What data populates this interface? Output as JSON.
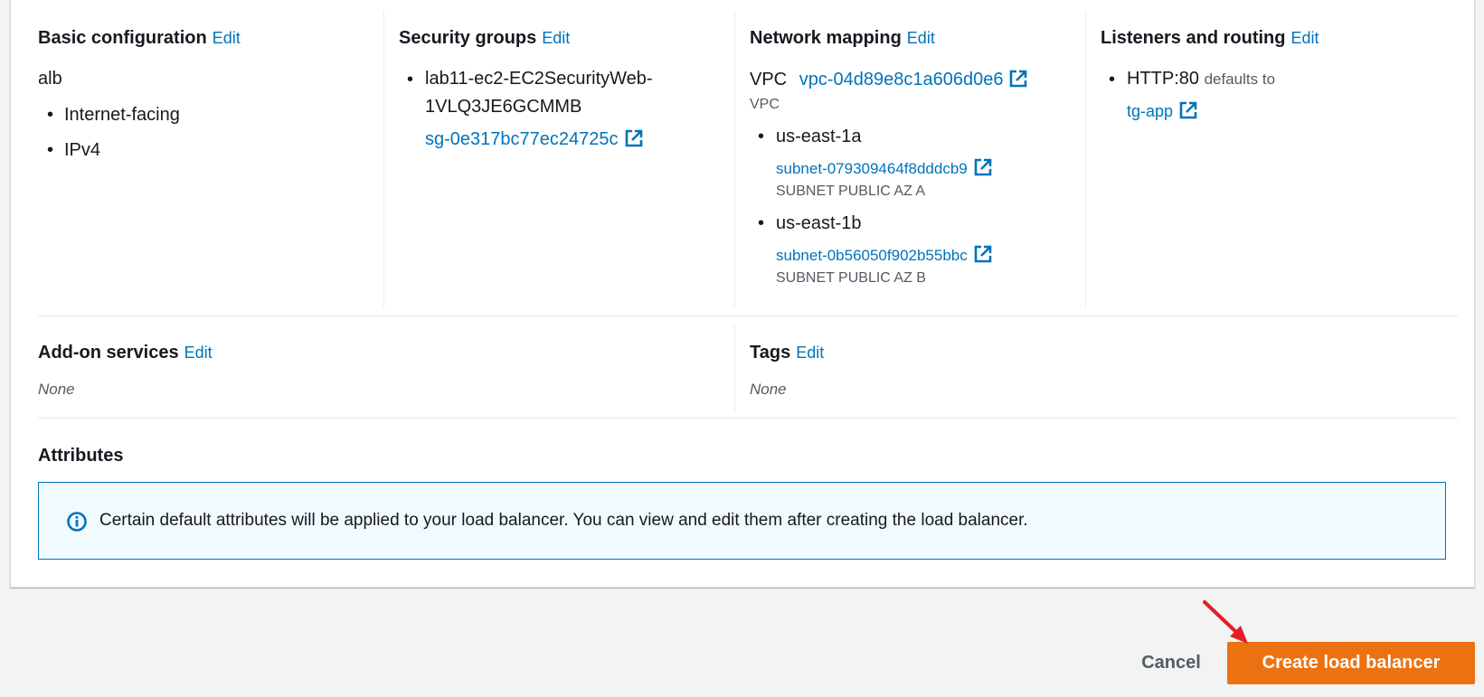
{
  "sections": {
    "basic": {
      "title": "Basic configuration",
      "edit": "Edit",
      "name": "alb",
      "items": [
        "Internet-facing",
        "IPv4"
      ]
    },
    "security": {
      "title": "Security groups",
      "edit": "Edit",
      "group_name_line1": "lab11-ec2-EC2SecurityWeb-",
      "group_name_line2": "1VLQ3JE6GCMMB",
      "group_id": "sg-0e317bc77ec24725c"
    },
    "network": {
      "title": "Network mapping",
      "edit": "Edit",
      "vpc_label": "VPC",
      "vpc_id": "vpc-04d89e8c1a606d0e6",
      "vpc_caption": "VPC",
      "zones": [
        {
          "az": "us-east-1a",
          "subnet": "subnet-079309464f8dddcb9",
          "subnet_name": "SUBNET PUBLIC AZ A"
        },
        {
          "az": "us-east-1b",
          "subnet": "subnet-0b56050f902b55bbc",
          "subnet_name": "SUBNET PUBLIC AZ B"
        }
      ]
    },
    "listeners": {
      "title": "Listeners and routing",
      "edit": "Edit",
      "listener": "HTTP:80",
      "defaults_to": "defaults to",
      "target_group": "tg-app"
    },
    "addons": {
      "title": "Add-on services",
      "edit": "Edit",
      "value": "None"
    },
    "tags": {
      "title": "Tags",
      "edit": "Edit",
      "value": "None"
    },
    "attributes": {
      "title": "Attributes",
      "info": "Certain default attributes will be applied to your load balancer. You can view and edit them after creating the load balancer."
    }
  },
  "actions": {
    "cancel": "Cancel",
    "create": "Create load balancer"
  },
  "colors": {
    "link": "#0073bb",
    "primary": "#ec7211",
    "annotation_arrow": "#e41e26"
  }
}
